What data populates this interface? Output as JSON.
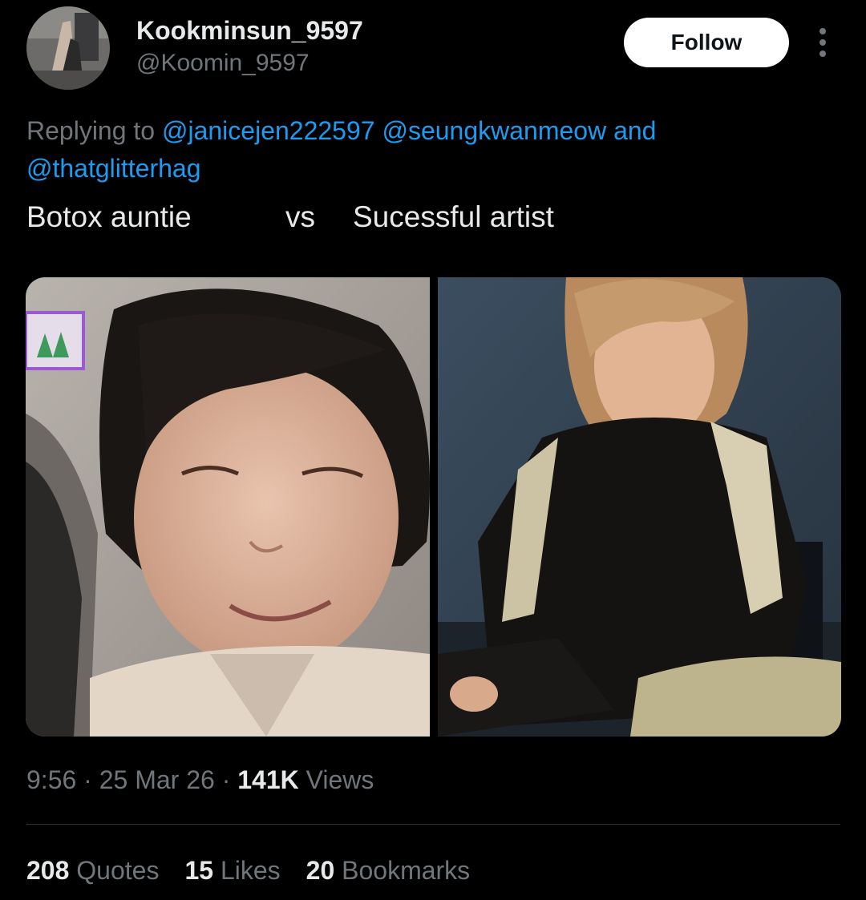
{
  "author": {
    "display_name": "Kookminsun_9597",
    "handle": "@Koomin_9597",
    "avatar_icon": "avatar-photo"
  },
  "follow_label": "Follow",
  "more_icon": "more-vertical-icon",
  "reply": {
    "prefix": "Replying to",
    "mentions": [
      "@janicejen222597",
      "@seungkwanmeow",
      "@thatglitterhag"
    ],
    "and_text": "and"
  },
  "tweet_text": {
    "left": "Botox auntie",
    "middle": "vs",
    "right": "Sucessful artist"
  },
  "meta": {
    "time": "9:56",
    "date": "25 Mar 26",
    "views_count": "141K",
    "views_label": "Views",
    "sep": "·"
  },
  "stats": [
    {
      "count": "208",
      "label": "Quotes"
    },
    {
      "count": "15",
      "label": "Likes"
    },
    {
      "count": "20",
      "label": "Bookmarks"
    }
  ],
  "colors": {
    "background": "#000000",
    "text_primary": "#e7e9ea",
    "text_secondary": "#71767b",
    "link": "#1d9bf0",
    "divider": "#2f3336",
    "follow_bg": "#ffffff"
  }
}
